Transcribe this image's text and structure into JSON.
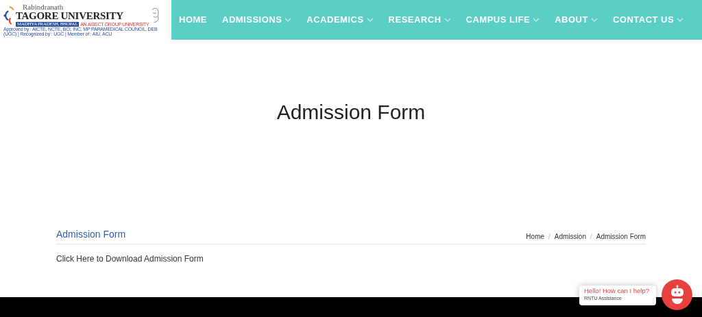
{
  "logo": {
    "line_1": "Rabindranath",
    "line_2": "TAGORE UNIVERSITY",
    "location": "MADHYA PRADESH, BHOPAL",
    "group": "AN AISECT GROUP UNIVERSITY",
    "approvals": "Approved by : AICTE, NCTE, BCI, INC, MP PARAMEDICAL COUNCIL, DEB (UGC) | Recognized by : UGC | Member of : AIU, ACU"
  },
  "nav": [
    {
      "label": "HOME",
      "dropdown": false
    },
    {
      "label": "ADMISSIONS",
      "dropdown": true
    },
    {
      "label": "ACADEMICS",
      "dropdown": true
    },
    {
      "label": "RESEARCH",
      "dropdown": true
    },
    {
      "label": "CAMPUS LIFE",
      "dropdown": true
    },
    {
      "label": "ABOUT",
      "dropdown": true
    },
    {
      "label": "CONTACT US",
      "dropdown": true
    }
  ],
  "page_title": "Admission Form",
  "section": {
    "heading": "Admission Form",
    "breadcrumb": [
      "Home",
      "Admission",
      "Admission Form"
    ],
    "breadcrumb_separator": "/",
    "link": "Click Here to Download Admission Form"
  },
  "chat": {
    "greeting": "Hello! How can I help?",
    "subtitle": "RNTU Assistance"
  }
}
